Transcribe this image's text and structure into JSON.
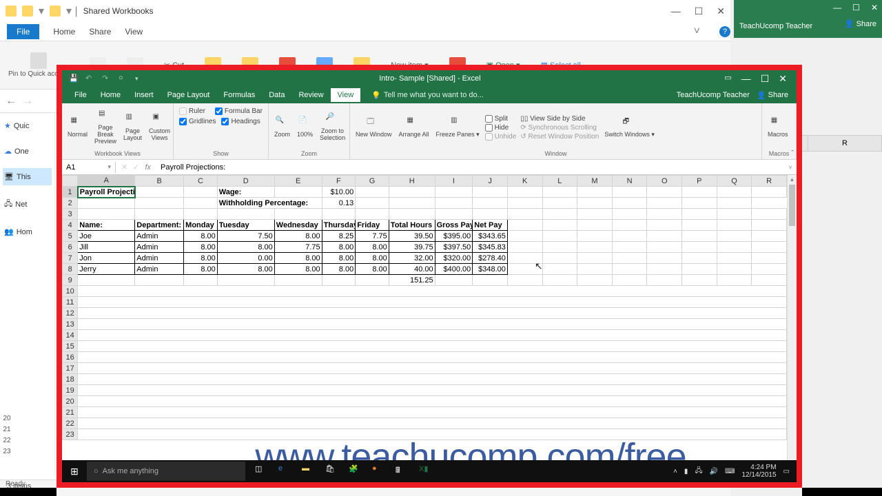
{
  "bg_explorer": {
    "title": "Shared Workbooks",
    "file_tab": "File",
    "tabs": [
      "Home",
      "Share",
      "View"
    ],
    "ribbon": {
      "pin_label": "Pin to Quick access",
      "cut": "Cut",
      "new_item": "New item ▾",
      "open": "Open ▾",
      "select_all": "Select all"
    },
    "sidebar": [
      "Quic",
      "One",
      "This",
      "Net",
      "Hom"
    ],
    "status": "3 items"
  },
  "bg_excel2": {
    "user": "TeachUcomp Teacher",
    "share": "Share"
  },
  "excel": {
    "title": "Intro- Sample  [Shared] - Excel",
    "tabs": [
      "File",
      "Home",
      "Insert",
      "Page Layout",
      "Formulas",
      "Data",
      "Review",
      "View"
    ],
    "active_tab": "View",
    "tellme": "Tell me what you want to do...",
    "user": "TeachUcomp Teacher",
    "share": "Share",
    "ribbon": {
      "workbook_views": {
        "label": "Workbook Views",
        "normal": "Normal",
        "page_break": "Page Break Preview",
        "page_layout": "Page Layout",
        "custom": "Custom Views"
      },
      "show": {
        "label": "Show",
        "ruler": "Ruler",
        "gridlines": "Gridlines",
        "formula_bar": "Formula Bar",
        "headings": "Headings"
      },
      "zoom": {
        "label": "Zoom",
        "zoom": "Zoom",
        "hundred": "100%",
        "zoom_sel": "Zoom to Selection"
      },
      "window": {
        "label": "Window",
        "new_win": "New Window",
        "arrange": "Arrange All",
        "freeze": "Freeze Panes ▾",
        "split": "Split",
        "hide": "Hide",
        "unhide": "Unhide",
        "side": "View Side by Side",
        "sync": "Synchronous Scrolling",
        "reset": "Reset Window Position",
        "switch": "Switch Windows ▾"
      },
      "macros": {
        "label": "Macros",
        "macros": "Macros"
      }
    },
    "formula": {
      "cell": "A1",
      "value": "Payroll Projections:"
    },
    "cols": [
      "A",
      "B",
      "C",
      "D",
      "E",
      "F",
      "G",
      "H",
      "I",
      "J",
      "K",
      "L",
      "M",
      "N",
      "O",
      "P",
      "Q",
      "R"
    ],
    "data": {
      "r1": {
        "A": "Payroll Projections:",
        "D": "Wage:",
        "F": "$10.00"
      },
      "r2": {
        "D": "Withholding Percentage:",
        "F": "0.13"
      },
      "r4": [
        "Name:",
        "Department:",
        "Monday",
        "Tuesday",
        "Wednesday",
        "Thursday",
        "Friday",
        "Total Hours",
        "Gross Pay",
        "Net Pay"
      ],
      "r5": [
        "Joe",
        "Admin",
        "8.00",
        "7.50",
        "8.00",
        "8.25",
        "7.75",
        "39.50",
        "$395.00",
        "$343.65"
      ],
      "r6": [
        "Jill",
        "Admin",
        "8.00",
        "8.00",
        "7.75",
        "8.00",
        "8.00",
        "39.75",
        "$397.50",
        "$345.83"
      ],
      "r7": [
        "Jon",
        "Admin",
        "8.00",
        "0.00",
        "8.00",
        "8.00",
        "8.00",
        "32.00",
        "$320.00",
        "$278.40"
      ],
      "r8": [
        "Jerry",
        "Admin",
        "8.00",
        "8.00",
        "8.00",
        "8.00",
        "8.00",
        "40.00",
        "$400.00",
        "$348.00"
      ],
      "r9_H": "151.25"
    }
  },
  "watermark": "www.teachucomp.com/free",
  "taskbar": {
    "search_placeholder": "Ask me anything",
    "time": "4:24 PM",
    "date": "12/14/2015"
  },
  "colors": {
    "excel_green": "#217346",
    "red_border": "#ed1c24",
    "link_blue": "#3b5ca0"
  }
}
